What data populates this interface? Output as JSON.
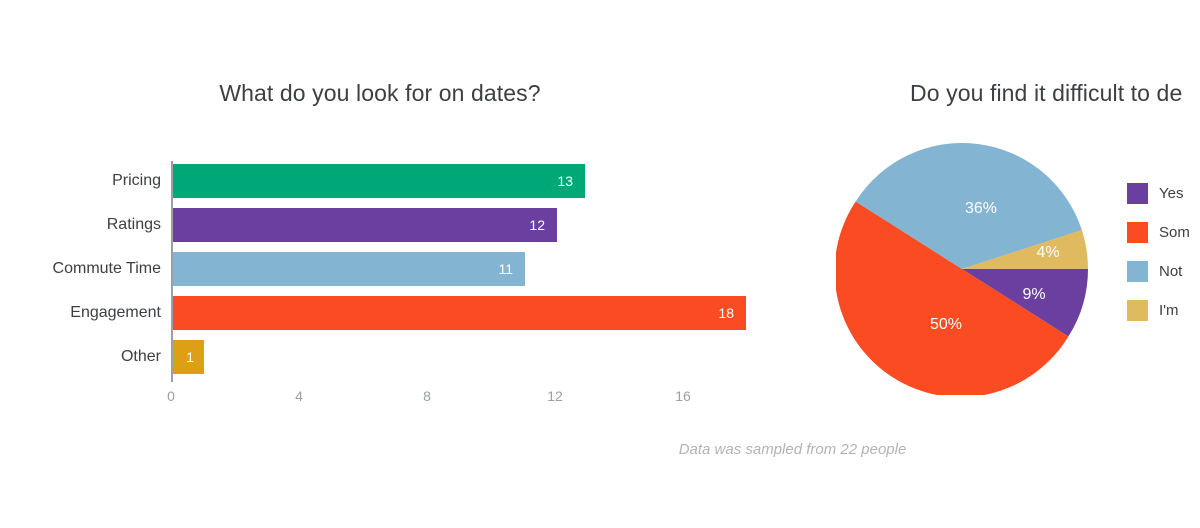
{
  "footnote": "Data was sampled from 22 people",
  "chart_data": [
    {
      "type": "bar",
      "orientation": "horizontal",
      "title": "What do you look for on dates?",
      "xlabel": "",
      "ylabel": "",
      "categories": [
        "Pricing",
        "Ratings",
        "Commute Time",
        "Engagement",
        "Other"
      ],
      "values": [
        13,
        12,
        11,
        18,
        1
      ],
      "value_labels": [
        "13",
        "12",
        "11",
        "18",
        "1"
      ],
      "colors": [
        "#00a878",
        "#6b3fa0",
        "#83b4d1",
        "#fa4b23",
        "#dda015"
      ],
      "xticks": [
        0,
        4,
        8,
        12,
        16
      ],
      "xtick_labels": [
        "0",
        "4",
        "8",
        "12",
        "16"
      ],
      "xlim": [
        0,
        19
      ],
      "grid": false,
      "legend": "none"
    },
    {
      "type": "pie",
      "title": "Do you find it difficult to de",
      "title_truncated": true,
      "labels": [
        "Yes",
        "Som",
        "Not",
        "I'm"
      ],
      "labels_truncated": true,
      "values": [
        9,
        50,
        36,
        4
      ],
      "value_labels": [
        "9%",
        "50%",
        "36%",
        "4%"
      ],
      "colors": [
        "#6b3fa0",
        "#fa4b23",
        "#83b4d1",
        "#dfb košt"
      ],
      "slice_colors": [
        "#6b3fa0",
        "#fa4b23",
        "#83b4d1",
        "#e0ba5e"
      ],
      "start_angle_deg": 0,
      "direction": "clockwise",
      "legend": "right"
    }
  ]
}
